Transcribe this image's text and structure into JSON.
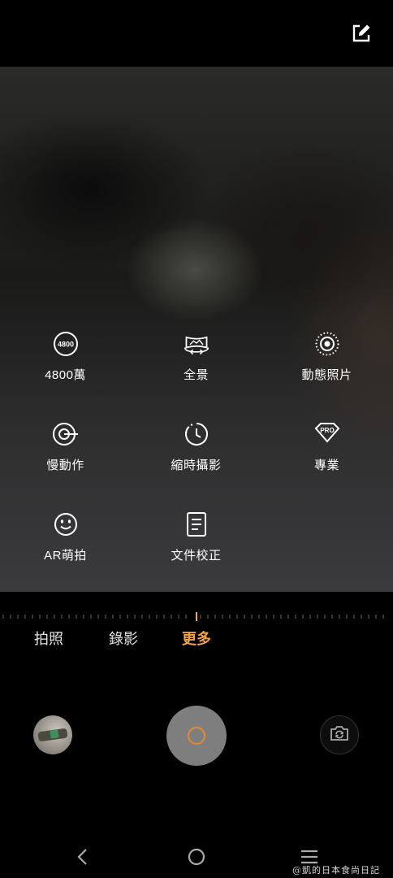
{
  "colors": {
    "accent": "#f2a245",
    "shutter": "#7e7e7e",
    "shutter_ring": "#e48a2f"
  },
  "top_bar": {
    "edit_icon": "edit-icon"
  },
  "modes": [
    {
      "label": "4800萬",
      "icon": "48mp-icon",
      "badge": "4800"
    },
    {
      "label": "全景",
      "icon": "panorama-icon"
    },
    {
      "label": "動態照片",
      "icon": "live-photo-icon"
    },
    {
      "label": "慢動作",
      "icon": "slow-motion-icon"
    },
    {
      "label": "縮時攝影",
      "icon": "timelapse-icon"
    },
    {
      "label": "專業",
      "icon": "pro-mode-icon",
      "badge": "PRO"
    },
    {
      "label": "AR萌拍",
      "icon": "ar-emoji-icon"
    },
    {
      "label": "文件校正",
      "icon": "document-scan-icon"
    }
  ],
  "tabs": [
    {
      "label": "拍照",
      "active": false
    },
    {
      "label": "錄影",
      "active": false
    },
    {
      "label": "更多",
      "active": true
    }
  ],
  "controls": {
    "gallery_icon": "gallery-thumbnail",
    "shutter_icon": "shutter-button-icon",
    "switch_icon": "switch-camera-icon"
  },
  "nav": {
    "back_icon": "back-icon",
    "home_icon": "home-icon",
    "menu_icon": "menu-icon"
  },
  "watermark": "@凱的日本食尚日記"
}
